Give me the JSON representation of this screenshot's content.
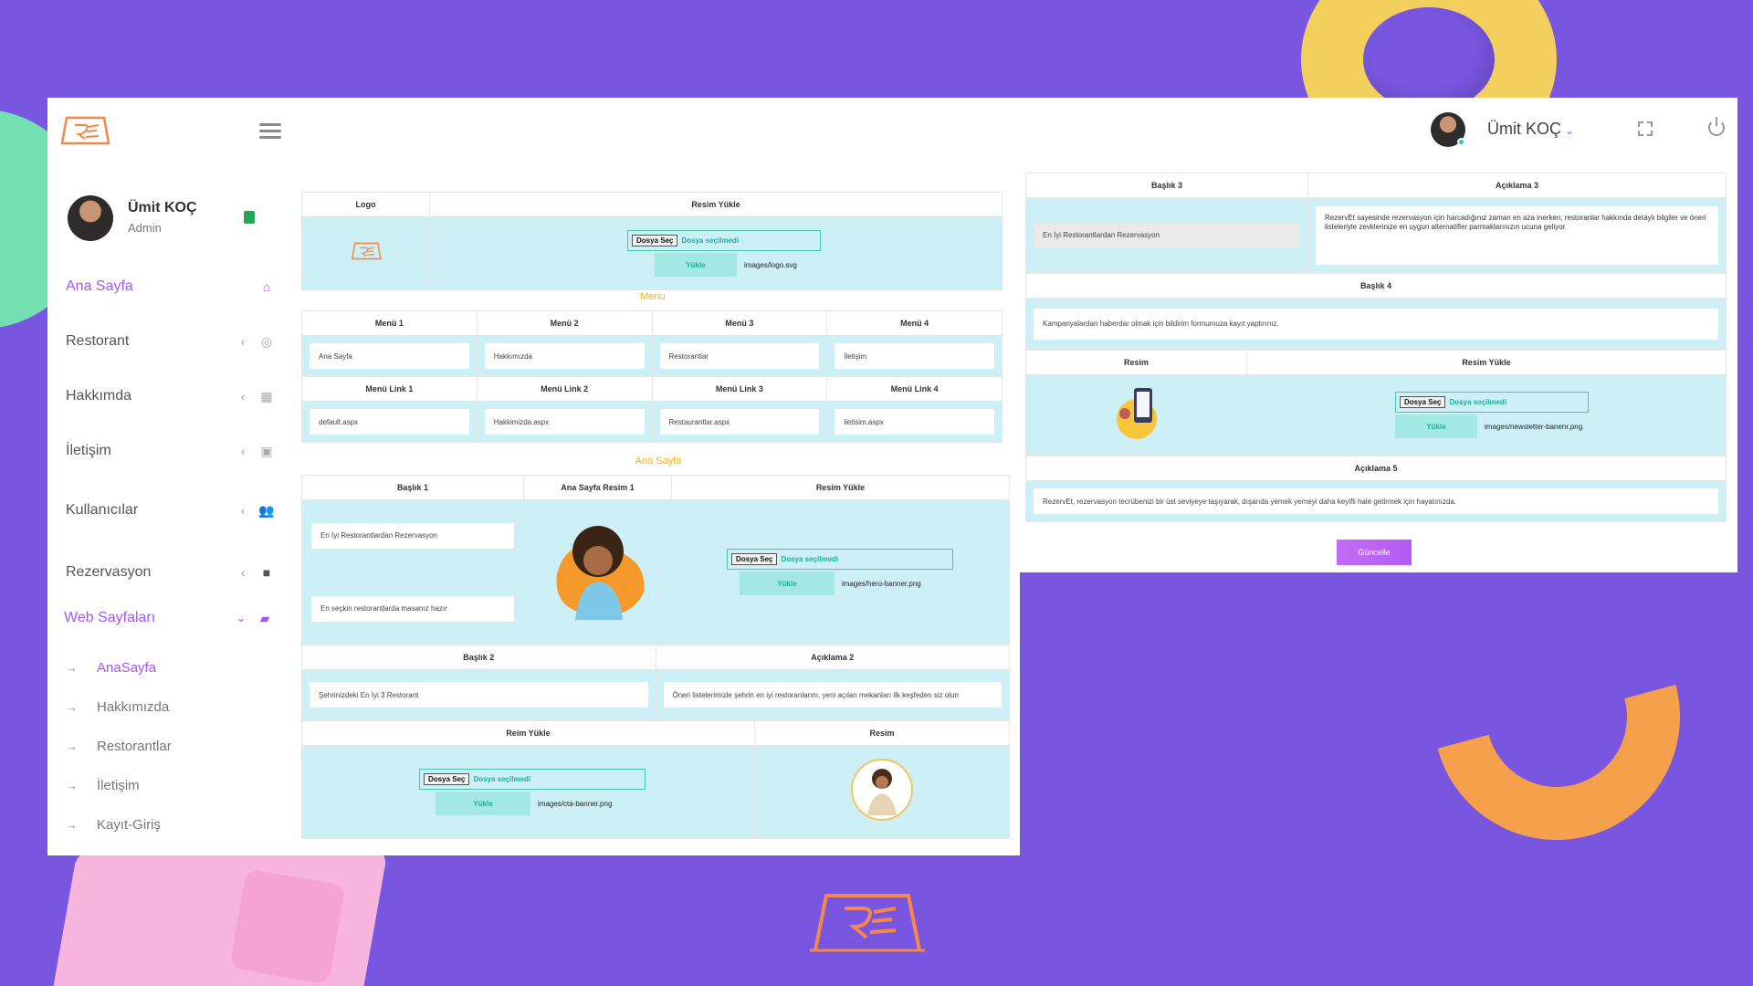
{
  "brand": {
    "accent": "#a855f7",
    "bg": "#7856e0",
    "logo_text": "REZERVET"
  },
  "sidebar": {
    "user_name": "Ümit KOÇ",
    "user_role": "Admin",
    "items": [
      {
        "label": "Ana Sayfa",
        "icon": "home-icon"
      },
      {
        "label": "Restorant",
        "icon": "target-icon"
      },
      {
        "label": "Hakkımda",
        "icon": "grid-icon"
      },
      {
        "label": "İletişim",
        "icon": "contact-card-icon"
      },
      {
        "label": "Kullanıcılar",
        "icon": "users-icon"
      },
      {
        "label": "Rezervasyon",
        "icon": "square-icon"
      },
      {
        "label": "Web Sayfaları",
        "icon": "bag-icon"
      }
    ],
    "subitems": [
      "AnaSayfa",
      "Hakkımızda",
      "Restorantlar",
      "İletişim",
      "Kayıt-Giriş"
    ]
  },
  "topbar": {
    "user_name": "Ümit KOÇ"
  },
  "common": {
    "choose_file": "Dosya Seç",
    "no_file": "Dosya seçilmedi",
    "upload": "Yükle"
  },
  "logo_section": {
    "col_logo": "Logo",
    "col_upload": "Resim Yükle",
    "path": "images/logo.svg"
  },
  "menu_section": {
    "title": "Menu",
    "headers": [
      "Menü 1",
      "Menü 2",
      "Menü 3",
      "Menü 4"
    ],
    "values": [
      "Ana Sayfa",
      "Hakkımızda",
      "Restorantlar",
      "İletişim"
    ],
    "link_headers": [
      "Menü Link 1",
      "Menü Link 2",
      "Menü Link 3",
      "Menü Link 4"
    ],
    "links": [
      "default.aspx",
      "Hakkimizda.aspx",
      "Restaurantlar.aspx",
      "iletisim.aspx"
    ]
  },
  "home_section": {
    "title": "Ana Sayfa",
    "h_baslik1": "Başlık 1",
    "h_resim1": "Ana Sayfa Resim 1",
    "h_resim_yukle": "Resim Yükle",
    "baslik1_value": "En İyi Restorantlardan Rezervasyon",
    "baslik1_sub": "En seçkin restorantlarda masanız hazır",
    "resim1_path": "images/hero-banner.png",
    "h_baslik2": "Başlık 2",
    "h_aciklama2": "Açıklama 2",
    "baslik2_value": "Şehrinizdeki En İyi 3 Restorant",
    "aciklama2_value": "Öneri listelerimizle şehrin en iyi restoranlarını, yeni açılan mekanları ilk keşfeden siz olun",
    "h_reim_yukle": "Reim Yükle",
    "h_resim": "Resim",
    "cta_path": "images/cta-banner.png"
  },
  "right_section": {
    "h_baslik3": "Başlık 3",
    "h_aciklama3": "Açıklama 3",
    "baslik3_value": "En İyi Restorantlardan Rezervasyon",
    "aciklama3_value": "RezervEt sayesinde rezervasyon için harcadığınız zaman en aza inerken, restoranlar hakkında detaylı bilgiler ve öneri listeleriyle zevklerinize en uygun alternatifler parmaklarınızın ucuna geliyor.",
    "h_baslik4": "Başlık 4",
    "baslik4_value": "Kampanyalardan haberdar olmak için bildirim formumuza kayıt yaptırınız.",
    "h_resim": "Resim",
    "h_resim_yukle": "Resim Yükle",
    "newsletter_path": "images/newsletter-banenr.png",
    "h_aciklama5": "Açıklama 5",
    "aciklama5_value": "RezervEt, rezervasyon tecrübenizi bir üst seviyeye taşıyarak, dışarıda yemek yemeyi daha keyifli hale getirmek için hayatınızda.",
    "update_button": "Güncelle"
  }
}
